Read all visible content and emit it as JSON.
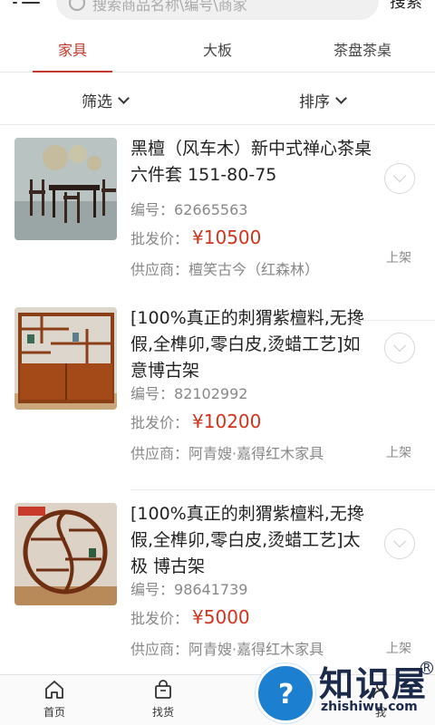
{
  "search": {
    "placeholder": "搜索商品名称\\编号\\商家",
    "button_label": "搜索",
    "menu_icon": "menu-icon",
    "search_icon": "search-icon"
  },
  "tabs": [
    {
      "label": "家具",
      "active": true
    },
    {
      "label": "大板",
      "active": false
    },
    {
      "label": "茶盘茶桌",
      "active": false
    }
  ],
  "filters": {
    "filter_label": "筛选",
    "sort_label": "排序"
  },
  "products": [
    {
      "title": "黑檀（风车木）新中式禅心茶桌 六件套 151-80-75",
      "code_label": "编号：",
      "code": "62665563",
      "price_label": "批发价：",
      "price": "¥10500",
      "supplier_label": "供应商：",
      "supplier": "檀笑古今（红森林）",
      "status": "上架"
    },
    {
      "title": "[100%真正的刺猬紫檀料,无搀假,全榫卯,零白皮,烫蜡工艺]如意博古架",
      "code_label": "编号：",
      "code": "82102992",
      "price_label": "批发价：",
      "price": "¥10200",
      "supplier_label": "供应商：",
      "supplier": "阿青嫂·嘉得红木家具",
      "status": "上架"
    },
    {
      "title": "[100%真正的刺猬紫檀料,无搀假,全榫卯,零白皮,烫蜡工艺]太极 博古架",
      "code_label": "编号：",
      "code": "98641739",
      "price_label": "批发价：",
      "price": "¥5000",
      "supplier_label": "供应商：",
      "supplier": "阿青嫂·嘉得红木家具",
      "status": "上架"
    }
  ],
  "bottom_nav": [
    {
      "label": "首页",
      "icon": "home-icon"
    },
    {
      "label": "找货",
      "icon": "shopping-bag-icon"
    },
    {
      "label": "我",
      "icon": "user-icon"
    }
  ],
  "watermark": {
    "text": "知识屋",
    "url": "zhishiwu.com"
  },
  "colors": {
    "accent": "#c0392b",
    "price": "#d0341f"
  }
}
